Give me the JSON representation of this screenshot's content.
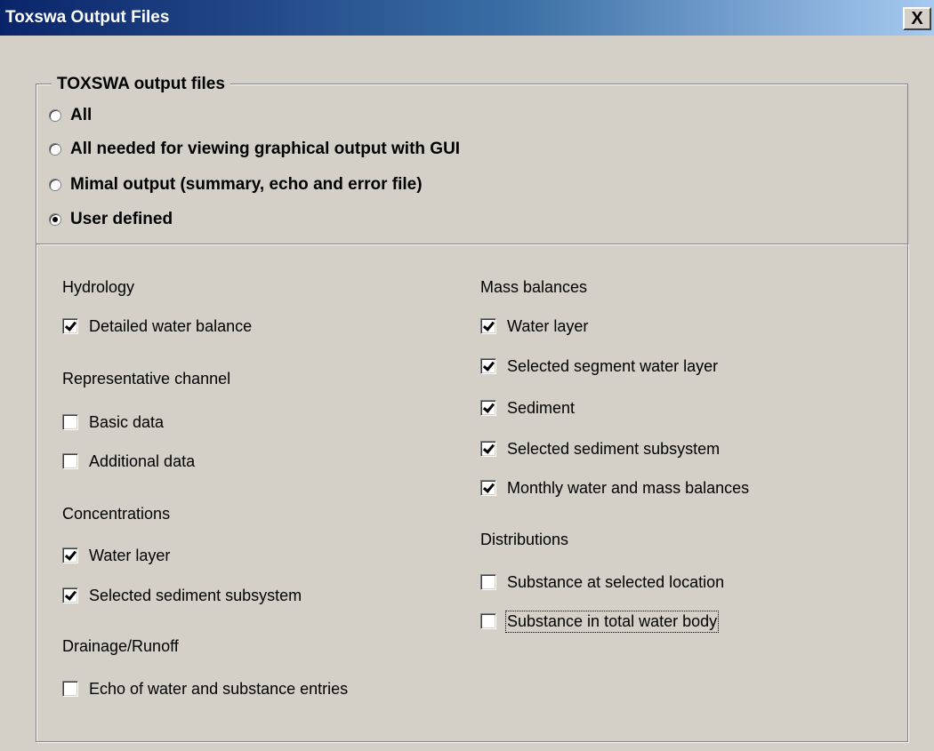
{
  "window": {
    "title": "Toxswa Output Files",
    "close_glyph": "X"
  },
  "output_group": {
    "legend": "TOXSWA output files",
    "options": [
      {
        "label": "All",
        "selected": false
      },
      {
        "label": "All needed for viewing graphical output with GUI",
        "selected": false
      },
      {
        "label": "Mimal output (summary, echo and error file)",
        "selected": false
      },
      {
        "label": "User defined",
        "selected": true
      }
    ]
  },
  "user_defined": {
    "hydrology": {
      "heading": "Hydrology",
      "items": [
        {
          "label": "Detailed water balance",
          "checked": true
        }
      ]
    },
    "representative_channel": {
      "heading": "Representative channel",
      "items": [
        {
          "label": "Basic data",
          "checked": false
        },
        {
          "label": "Additional data",
          "checked": false
        }
      ]
    },
    "concentrations": {
      "heading": "Concentrations",
      "items": [
        {
          "label": "Water layer",
          "checked": true
        },
        {
          "label": "Selected sediment subsystem",
          "checked": true
        }
      ]
    },
    "drainage_runoff": {
      "heading": "Drainage/Runoff",
      "items": [
        {
          "label": "Echo of water and substance entries",
          "checked": false
        }
      ]
    },
    "mass_balances": {
      "heading": "Mass balances",
      "items": [
        {
          "label": "Water layer",
          "checked": true
        },
        {
          "label": "Selected segment water layer",
          "checked": true
        },
        {
          "label": "Sediment",
          "checked": true
        },
        {
          "label": "Selected sediment subsystem",
          "checked": true
        },
        {
          "label": "Monthly water and mass balances",
          "checked": true
        }
      ]
    },
    "distributions": {
      "heading": "Distributions",
      "items": [
        {
          "label": "Substance at selected location",
          "checked": false
        },
        {
          "label": "Substance in total water body",
          "checked": false
        }
      ]
    }
  }
}
